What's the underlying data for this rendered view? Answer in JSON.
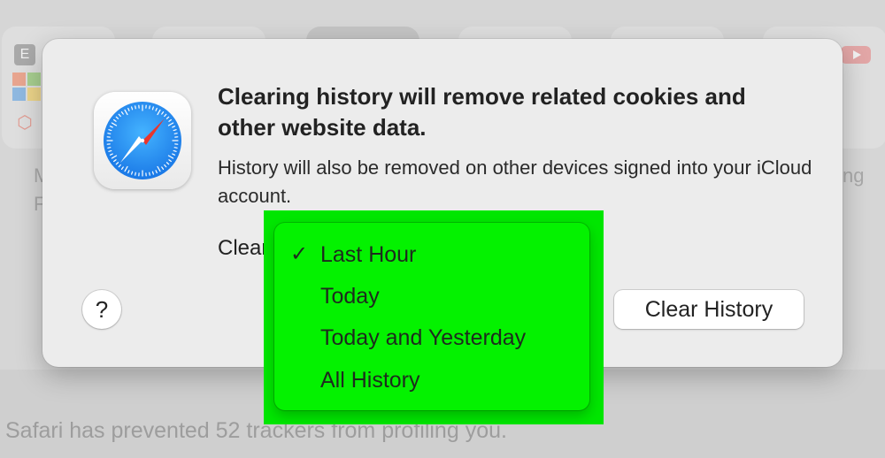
{
  "background": {
    "tracker_message": "Safari has prevented 52 trackers from profiling you.",
    "fragment_left_1": "M",
    "fragment_left_2": "F",
    "fragment_right": "ng",
    "tile_letter": "E"
  },
  "dialog": {
    "title": "Clearing history will remove related cookies and other website data.",
    "body": "History will also be removed on other devices signed into your iCloud account.",
    "clear_label": "Clear",
    "help_label": "?",
    "clear_history_button": "Clear History",
    "app_icon": "safari-compass-icon"
  },
  "menu": {
    "checkmark": "✓",
    "selected_index": 0,
    "items": [
      {
        "label": "Last Hour"
      },
      {
        "label": "Today"
      },
      {
        "label": "Today and Yesterday"
      },
      {
        "label": "All History"
      }
    ]
  },
  "colors": {
    "highlight": "#00e600",
    "safari_blue": "#1f8ef1",
    "compass_red": "#e8352c"
  }
}
